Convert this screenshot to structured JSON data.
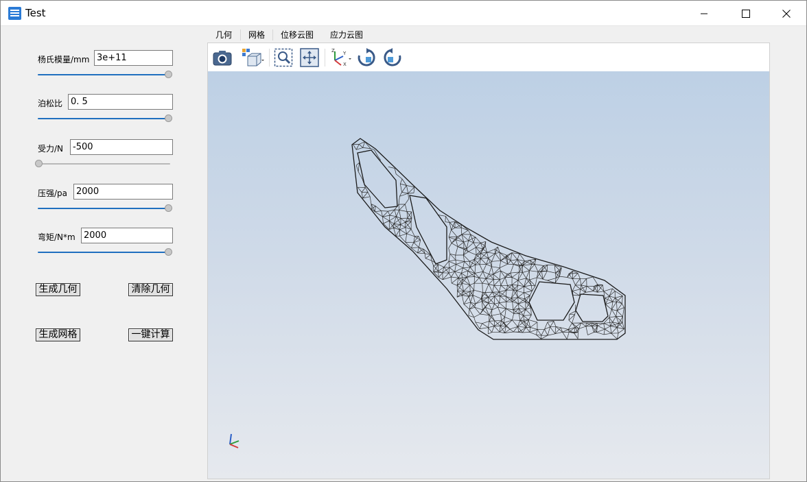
{
  "window": {
    "title": "Test"
  },
  "params": [
    {
      "label": "杨氏模量/mm",
      "value": "3e+11",
      "slider_fraction": 1.0
    },
    {
      "label": "泊松比",
      "value": "0. 5",
      "slider_fraction": 1.0
    },
    {
      "label": "受力/N",
      "value": "-500",
      "slider_fraction": 0.0
    },
    {
      "label": "压强/pa",
      "value": "2000",
      "slider_fraction": 1.0
    },
    {
      "label": "弯矩/N*m",
      "value": "2000",
      "slider_fraction": 1.0
    }
  ],
  "buttons": {
    "generate_geometry": "生成几何",
    "clear_geometry": "清除几何",
    "generate_mesh": "生成网格",
    "one_click_compute": "一键计算"
  },
  "tabs": [
    "几何",
    "网格",
    "位移云图",
    "应力云图"
  ],
  "toolbar": {
    "tools": [
      "camera-icon",
      "view-cube-icon",
      "zoom-box-icon",
      "fit-all-icon",
      "axes-dropdown-icon",
      "rotate-cw-icon",
      "rotate-ccw-icon"
    ]
  },
  "viewport": {
    "display_mode": "wireframe-mesh",
    "colors": {
      "mesh_line": "#2a2a2a",
      "bg_top": "#bdd0e5",
      "bg_bottom": "#e6e9ee",
      "slider_active": "#1f6fbf"
    }
  }
}
